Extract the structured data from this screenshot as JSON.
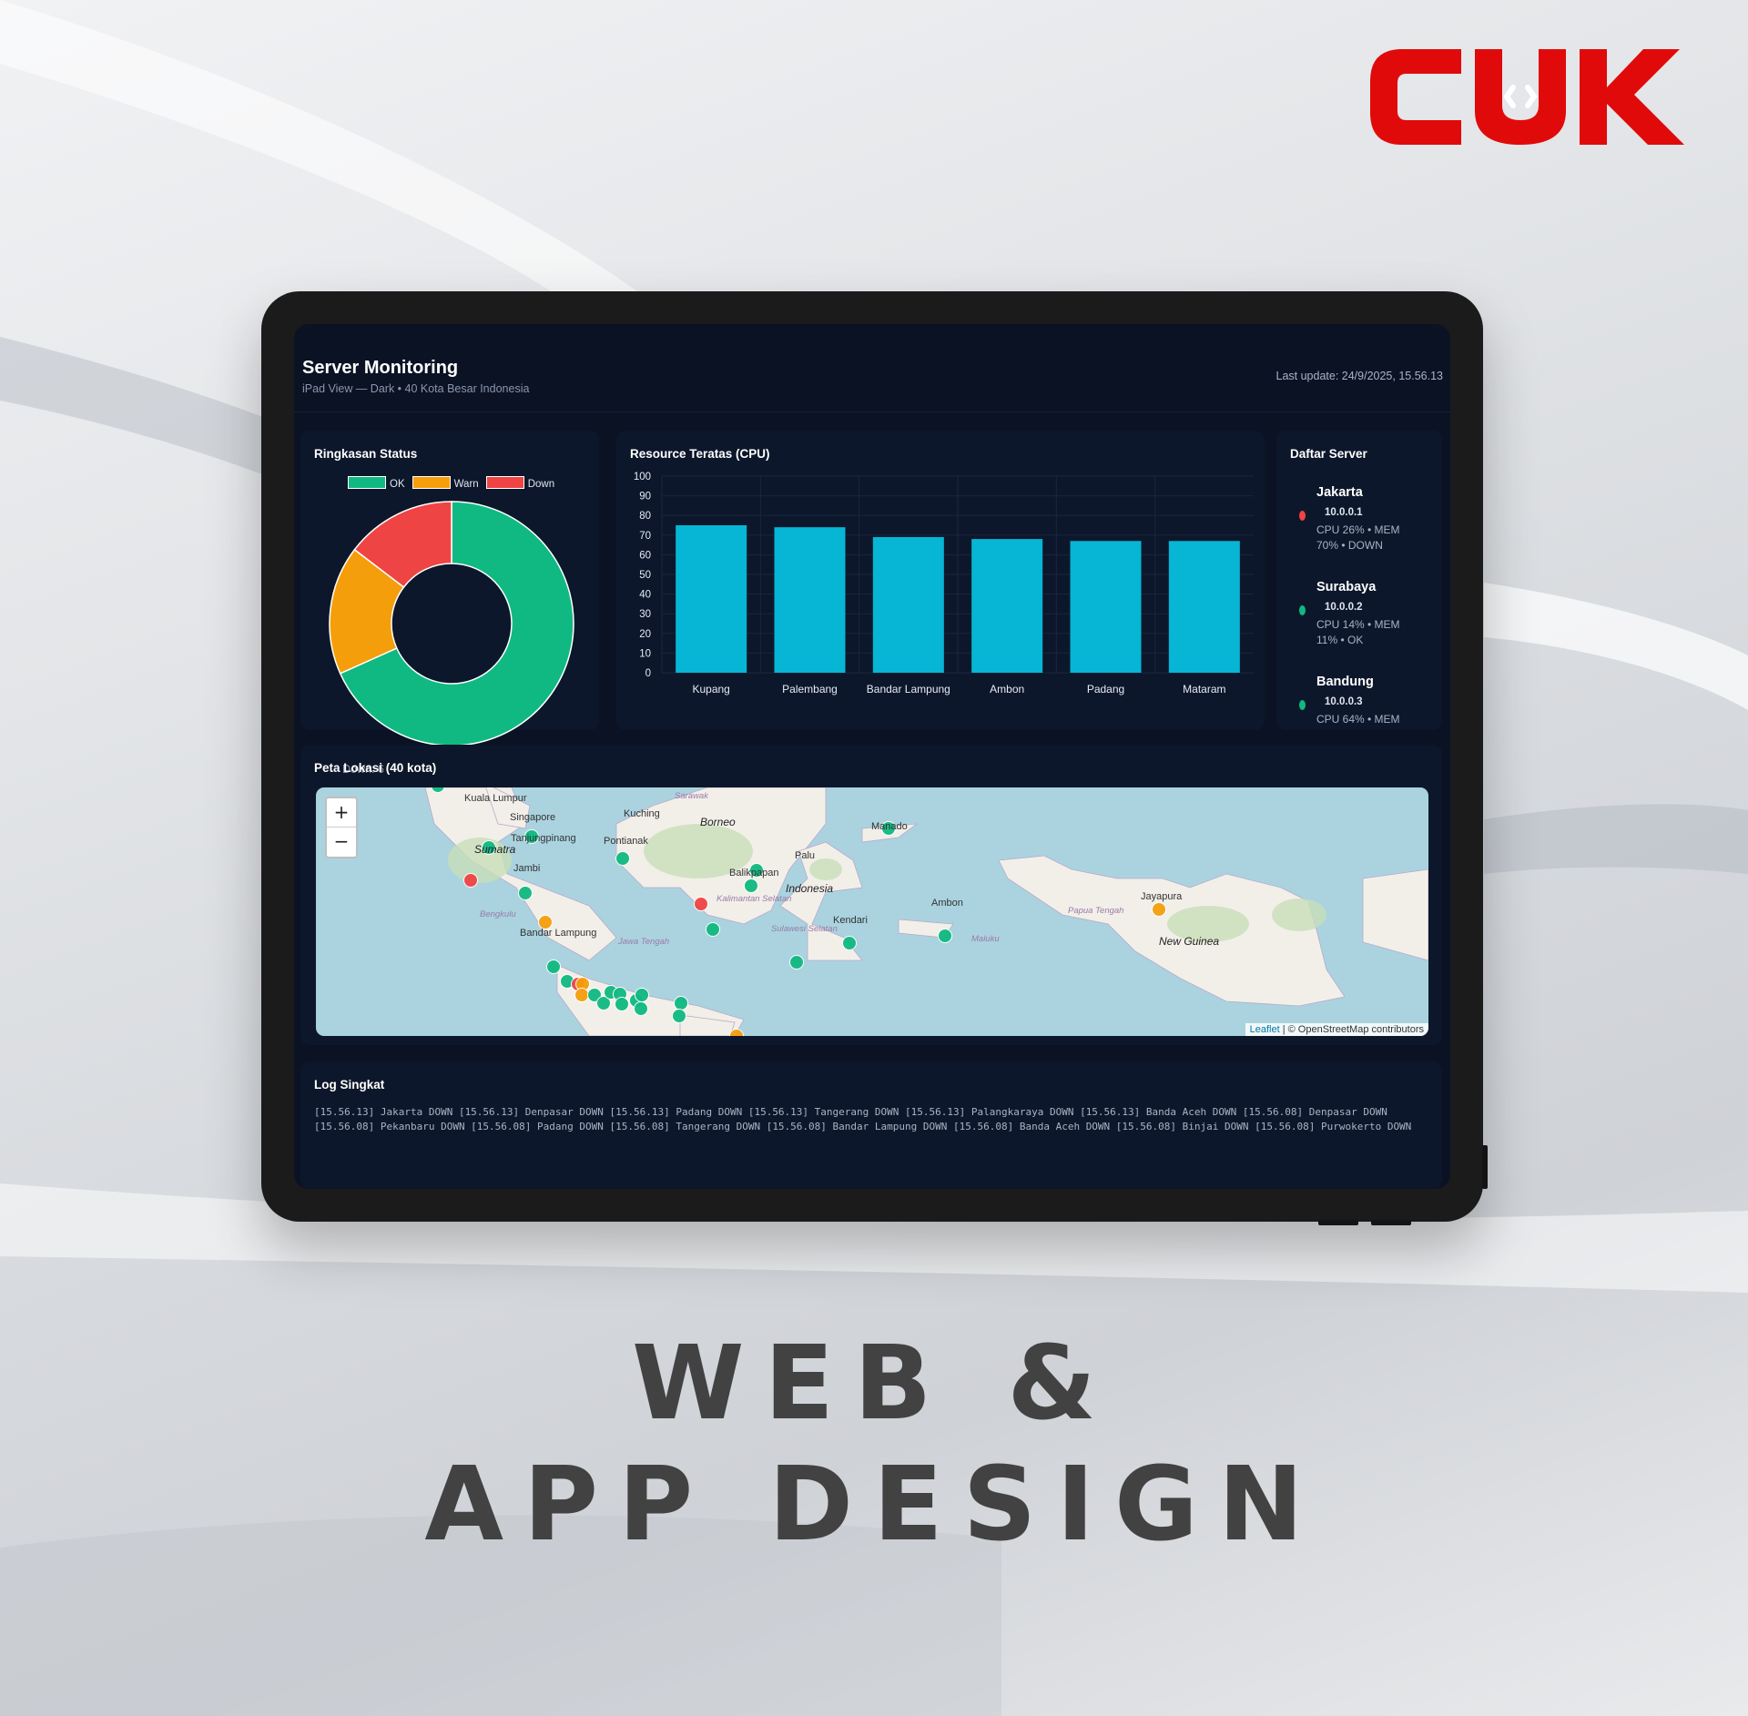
{
  "brand": {
    "logo_text": "CUK",
    "logo_color": "#e10a0a"
  },
  "poster": {
    "line1": "WEB &",
    "line2": "APP DESIGN"
  },
  "header": {
    "title": "Server Monitoring",
    "subtitle": "iPad View — Dark • 40 Kota Besar Indonesia",
    "last_update": "Last update: 24/9/2025, 15.56.13"
  },
  "status_panel": {
    "title": "Ringkasan Status",
    "legend": [
      {
        "label": "OK",
        "color": "#10b981"
      },
      {
        "label": "Warn",
        "color": "#f59e0b"
      },
      {
        "label": "Down",
        "color": "#ef4444"
      }
    ]
  },
  "cpu_panel": {
    "title": "Resource Teratas (CPU)"
  },
  "chart_data": [
    {
      "type": "pie",
      "title": "Ringkasan Status",
      "categories": [
        "OK",
        "Warn",
        "Down"
      ],
      "values": [
        28,
        7,
        6
      ],
      "colors": [
        "#10b981",
        "#f59e0b",
        "#ef4444"
      ],
      "legend": "top"
    },
    {
      "type": "bar",
      "title": "Resource Teratas (CPU)",
      "categories": [
        "Kupang",
        "Palembang",
        "Bandar Lampung",
        "Ambon",
        "Padang",
        "Mataram"
      ],
      "values": [
        75,
        74,
        69,
        68,
        67,
        67
      ],
      "ylim": [
        0,
        100
      ],
      "yticks": [
        0,
        10,
        20,
        30,
        40,
        50,
        60,
        70,
        80,
        90,
        100
      ],
      "bar_color": "#06b6d4"
    }
  ],
  "server_panel": {
    "title": "Daftar Server",
    "servers": [
      {
        "name": "Jakarta",
        "ip": "10.0.0.1",
        "detail": "CPU 26% • MEM 70% • DOWN",
        "status_color": "#ef4444"
      },
      {
        "name": "Surabaya",
        "ip": "10.0.0.2",
        "detail": "CPU 14% • MEM 11% • OK",
        "status_color": "#10b981"
      },
      {
        "name": "Bandung",
        "ip": "10.0.0.3",
        "detail": "CPU 64% • MEM",
        "status_color": "#10b981"
      }
    ]
  },
  "map_panel": {
    "title": "Peta Lokasi (40 kota)",
    "overlap_text": "Down: 6",
    "zoom_in": "+",
    "zoom_out": "−",
    "attribution_link": "Leaflet",
    "attribution_text": " | © OpenStreetMap contributors",
    "labels": {
      "kuala_lumpur": "Kuala Lumpur",
      "singapore": "Singapore",
      "tanjungpinang": "Tanjungpinang",
      "sumatra": "Sumatra",
      "jambi": "Jambi",
      "pontianak": "Pontianak",
      "kuching": "Kuching",
      "borneo": "Borneo",
      "balikpapan": "Balikpapan",
      "palu": "Palu",
      "manado": "Manado",
      "indonesia": "Indonesia",
      "kendari": "Kendari",
      "ambon": "Ambon",
      "jayapura": "Jayapura",
      "new_guinea": "New Guinea",
      "bandar_lampung": "Bandar Lampung",
      "bengkulu": "Bengkulu",
      "maluku": "Maluku",
      "sulawesi_selatan": "Sulawesi Selatan",
      "kalimantan_selatan": "Kalimantan Selatan",
      "papua_tengah": "Papua Tengah",
      "jawa_tengah": "Jawa Tengah",
      "sarawak": "Sarawak"
    }
  },
  "log_panel": {
    "title": "Log Singkat",
    "text": "[15.56.13] Jakarta DOWN [15.56.13] Denpasar DOWN [15.56.13] Padang DOWN [15.56.13] Tangerang DOWN [15.56.13] Palangkaraya DOWN [15.56.13] Banda Aceh DOWN [15.56.08] Denpasar DOWN [15.56.08] Pekanbaru DOWN [15.56.08] Padang DOWN [15.56.08] Tangerang DOWN [15.56.08] Bandar Lampung DOWN [15.56.08] Banda Aceh DOWN [15.56.08] Binjai DOWN [15.56.08] Purwokerto DOWN"
  }
}
